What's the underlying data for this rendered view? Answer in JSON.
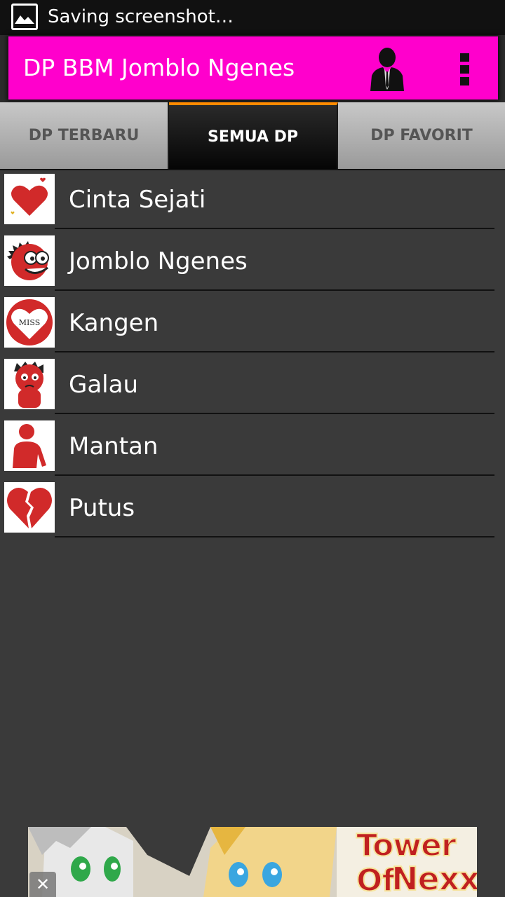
{
  "status_bar": {
    "notification_icon": "image-icon",
    "text": "Saving screenshot…"
  },
  "action_bar": {
    "title": "DP BBM Jomblo Ngenes",
    "color": "#ff00cc",
    "icons": [
      "profile-icon",
      "overflow-menu-icon"
    ]
  },
  "tabs": [
    {
      "label": "DP TERBARU",
      "active": false
    },
    {
      "label": "SEMUA DP",
      "active": true
    },
    {
      "label": "DP FAVORIT",
      "active": false
    }
  ],
  "categories": [
    {
      "label": "Cinta Sejati",
      "icon": "heart-icon"
    },
    {
      "label": "Jomblo Ngenes",
      "icon": "cartoon-face-icon"
    },
    {
      "label": "Kangen",
      "icon": "miss-heart-icon"
    },
    {
      "label": "Galau",
      "icon": "sad-character-icon"
    },
    {
      "label": "Mantan",
      "icon": "person-icon"
    },
    {
      "label": "Putus",
      "icon": "broken-heart-icon"
    }
  ],
  "ad": {
    "line1": "Tower Of",
    "line2": "Nexx",
    "close_label": "✕"
  },
  "colors": {
    "background": "#3a3a3a",
    "accent_tab": "#ff8a00",
    "icon_red": "#d12a2a"
  }
}
